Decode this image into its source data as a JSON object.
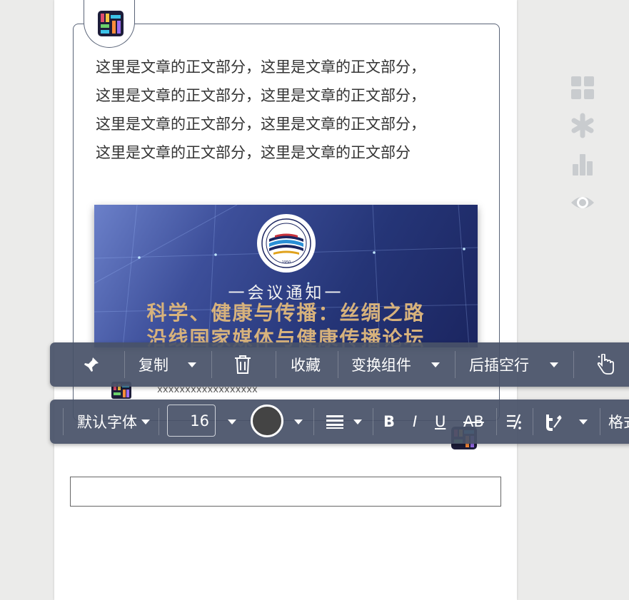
{
  "article": {
    "lines": [
      "这里是文章的正文部分，这里是文章的正文部分，",
      "这里是文章的正文部分，这里是文章的正文部分，",
      "这里是文章的正文部分，这里是文章的正文部分，",
      "这里是文章的正文部分，这里是文章的正文部分"
    ],
    "caption": "xxxxxxxxxxxxxxxxxx"
  },
  "banner": {
    "subtitle": "一会议通知一",
    "title_line1": "科学、健康与传播：丝绸之路",
    "title_line2": "沿线国家媒体与健康传播论坛",
    "logo_year": "1950",
    "brand_colors": {
      "navy": "#253577",
      "gold": "#d7b27c"
    }
  },
  "side_tools": [
    {
      "icon": "grid-icon"
    },
    {
      "icon": "asterisk-icon"
    },
    {
      "icon": "bar-chart-icon"
    },
    {
      "icon": "eye-icon"
    }
  ],
  "toolbar_actions": {
    "pin_icon": "pin-icon",
    "copy": "复制",
    "delete_icon": "trash-icon",
    "favorite": "收藏",
    "switch_component": "变换组件",
    "insert_line_after": "后插空行",
    "pointer_icon": "hand-pointer-icon"
  },
  "toolbar_format": {
    "font_family": "默认字体",
    "font_size": "16",
    "font_color": "#444444",
    "align_icon": "align-icon",
    "bold": "B",
    "italic": "I",
    "underline": "U",
    "strikethrough": "AB",
    "clear_format_icon": "clear-format-icon",
    "text_style_icon": "text-style-icon",
    "format_label": "格式"
  },
  "colors": {
    "toolbar_bg": "#485268",
    "page_bg": "#ebebea"
  }
}
